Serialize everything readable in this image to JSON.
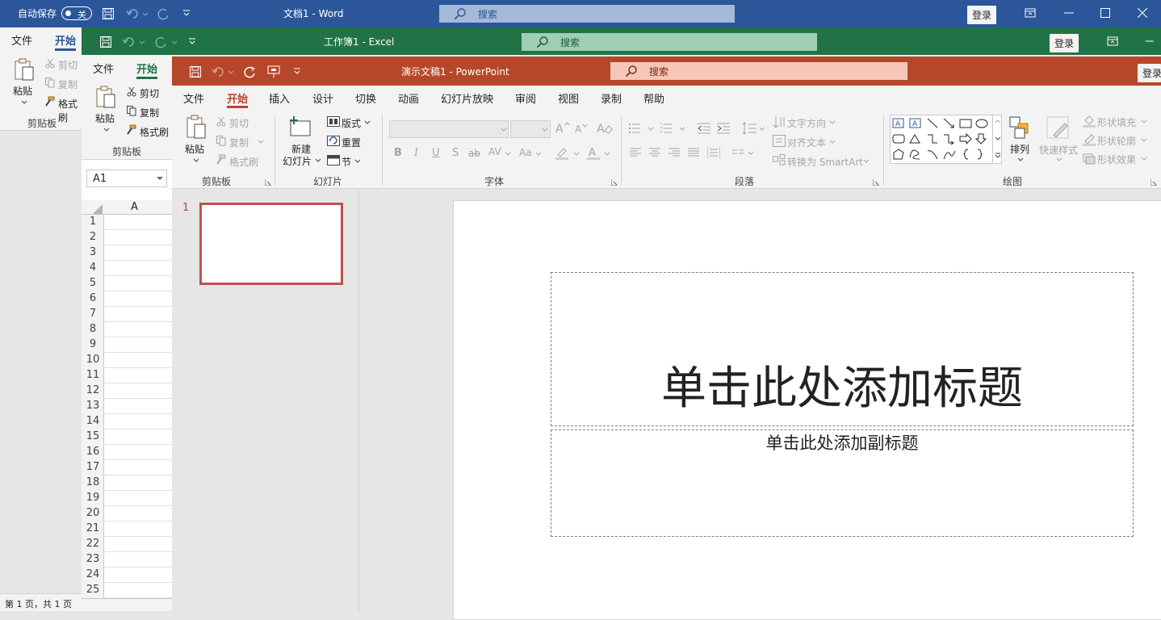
{
  "word": {
    "autosave_label": "自动保存",
    "autosave_state": "关",
    "title": "文档1  -  Word",
    "search_placeholder": "搜索",
    "login": "登录",
    "tabs": [
      "文件",
      "开始"
    ],
    "clipboard": {
      "paste": "粘贴",
      "cut": "剪切",
      "copy": "复制",
      "format_painter": "格式刷",
      "group": "剪贴板"
    },
    "status": "第 1 页，共 1 页"
  },
  "excel": {
    "title": "工作簿1  -  Excel",
    "search_placeholder": "搜索",
    "login": "登录",
    "tabs": [
      "文件",
      "开始"
    ],
    "clipboard": {
      "paste": "粘贴",
      "cut": "剪切",
      "copy": "复制",
      "format_painter": "格式刷",
      "group": "剪贴板"
    },
    "name_box": "A1",
    "column_header": "A",
    "rows": [
      "1",
      "2",
      "3",
      "4",
      "5",
      "6",
      "7",
      "8",
      "9",
      "10",
      "11",
      "12",
      "13",
      "14",
      "15",
      "16",
      "17",
      "18",
      "19",
      "20",
      "21",
      "22",
      "23",
      "24",
      "25"
    ]
  },
  "ppt": {
    "title": "演示文稿1  -  PowerPoint",
    "search_placeholder": "搜索",
    "login": "登录",
    "tabs": [
      "文件",
      "开始",
      "插入",
      "设计",
      "切换",
      "动画",
      "幻灯片放映",
      "审阅",
      "视图",
      "录制",
      "帮助"
    ],
    "active_tab": "开始",
    "clipboard": {
      "paste": "粘贴",
      "cut": "剪切",
      "copy": "复制",
      "format_painter": "格式刷",
      "group": "剪贴板"
    },
    "slides": {
      "new_slide_1": "新建",
      "new_slide_2": "幻灯片",
      "layout": "版式",
      "reset": "重置",
      "section": "节",
      "group": "幻灯片"
    },
    "font": {
      "group": "字体",
      "bold": "B",
      "italic": "I",
      "underline": "U",
      "shadow": "S",
      "strike": "ab",
      "spacing": "AV",
      "case": "Aa"
    },
    "paragraph": {
      "group": "段落",
      "text_direction": "文字方向",
      "align_text": "对齐文本",
      "smartart": "转换为 SmartArt"
    },
    "drawing": {
      "group": "绘图",
      "arrange": "排列",
      "quick_styles": "快速样式",
      "shape_fill": "形状填充",
      "shape_outline": "形状轮廓",
      "shape_effects": "形状效果"
    },
    "slide_number": "1",
    "title_placeholder": "单击此处添加标题",
    "subtitle_placeholder": "单击此处添加副标题"
  },
  "colors": {
    "word": "#2b579a",
    "excel": "#217346",
    "ppt": "#b7472a"
  }
}
